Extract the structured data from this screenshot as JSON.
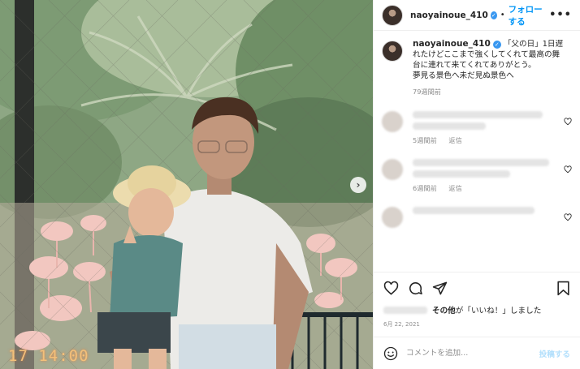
{
  "photo": {
    "timestamp_stamp": "17 14:00",
    "next_glyph": "›"
  },
  "header": {
    "username": "naoyainoue_410",
    "verified_glyph": "✓",
    "separator": "•",
    "follow_label": "フォローする",
    "more_glyph": "•••"
  },
  "caption": {
    "username": "naoyainoue_410",
    "text": " 「父の日」1日遅れたけどここまで強くしてくれて最高の舞台に連れて来てくれてありがとう。\n夢見る景色へ未だ見ぬ景色へ",
    "time": "79週間前"
  },
  "comments": [
    {
      "time": "5週間前",
      "reply_label": "返信"
    },
    {
      "time": "6週間前",
      "reply_label": "返信"
    },
    {
      "time": "",
      "reply_label": ""
    }
  ],
  "likes": {
    "text_others": "その他",
    "text_rest": "が「いいね！」しました"
  },
  "date": "6月 22, 2021",
  "add_comment": {
    "placeholder": "コメントを追加...",
    "post_label": "投稿する"
  },
  "colors": {
    "accent": "#0095f6",
    "verified": "#3897f0",
    "muted": "#8e8e8e",
    "post_disabled": "#b2dffc"
  }
}
